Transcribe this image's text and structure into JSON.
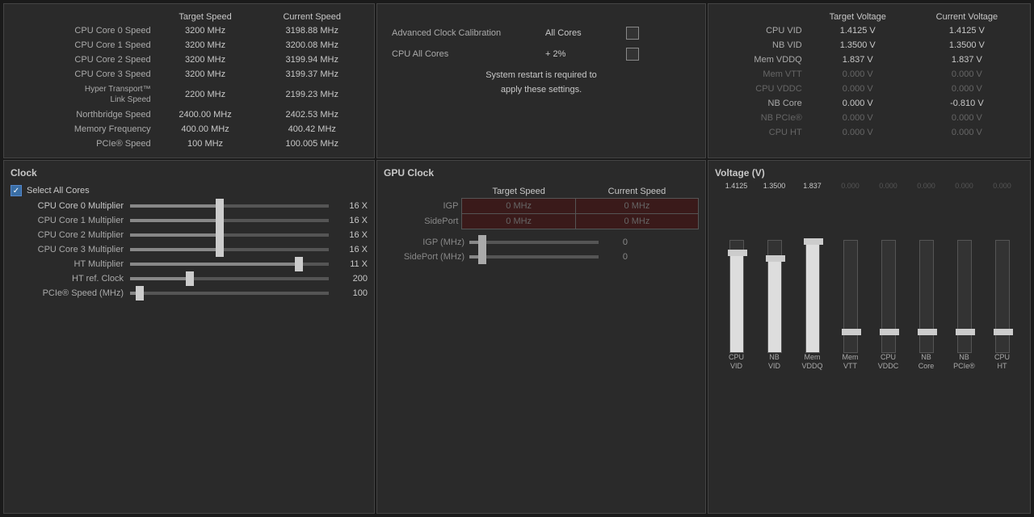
{
  "topLeft": {
    "headers": [
      "",
      "Target Speed",
      "Current Speed"
    ],
    "rows": [
      {
        "label": "CPU Core 0 Speed",
        "target": "3200 MHz",
        "current": "3198.88 MHz"
      },
      {
        "label": "CPU Core 1 Speed",
        "target": "3200 MHz",
        "current": "3200.08 MHz"
      },
      {
        "label": "CPU Core 2 Speed",
        "target": "3200 MHz",
        "current": "3199.94 MHz"
      },
      {
        "label": "CPU Core 3 Speed",
        "target": "3200 MHz",
        "current": "3199.37 MHz"
      },
      {
        "label": "Hyper Transport™ Link Speed",
        "target": "2200 MHz",
        "current": "2199.23 MHz",
        "hyper": true
      },
      {
        "label": "Northbridge Speed",
        "target": "2400.00 MHz",
        "current": "2402.53 MHz"
      },
      {
        "label": "Memory Frequency",
        "target": "400.00 MHz",
        "current": "400.42 MHz"
      },
      {
        "label": "PCIe® Speed",
        "target": "100 MHz",
        "current": "100.005 MHz"
      }
    ]
  },
  "topMid": {
    "calibLabel": "Advanced Clock Calibration",
    "calibValue": "All Cores",
    "cpuLabel": "CPU All Cores",
    "cpuValue": "+ 2%",
    "restartMsg": "System restart is required to\napply these settings."
  },
  "topRight": {
    "headers": [
      "",
      "Target Voltage",
      "Current Voltage"
    ],
    "rows": [
      {
        "label": "CPU VID",
        "target": "1.4125 V",
        "current": "1.4125 V",
        "dimmed": false
      },
      {
        "label": "NB VID",
        "target": "1.3500 V",
        "current": "1.3500 V",
        "dimmed": false
      },
      {
        "label": "Mem VDDQ",
        "target": "1.837 V",
        "current": "1.837 V",
        "dimmed": false
      },
      {
        "label": "Mem VTT",
        "target": "0.000 V",
        "current": "0.000 V",
        "dimmed": true
      },
      {
        "label": "CPU VDDC",
        "target": "0.000 V",
        "current": "0.000 V",
        "dimmed": true
      },
      {
        "label": "NB Core",
        "target": "0.000 V",
        "current": "-0.810 V",
        "dimmed": false
      },
      {
        "label": "NB PCIe®",
        "target": "0.000 V",
        "current": "0.000 V",
        "dimmed": true
      },
      {
        "label": "CPU HT",
        "target": "0.000 V",
        "current": "0.000 V",
        "dimmed": true
      }
    ]
  },
  "botLeft": {
    "title": "Clock",
    "selectAllLabel": "Select All Cores",
    "sliders": [
      {
        "label": "CPU Core 0 Multiplier",
        "value": "16 X",
        "pct": 45,
        "active": true
      },
      {
        "label": "CPU Core 1 Multiplier",
        "value": "16 X",
        "pct": 45,
        "active": false
      },
      {
        "label": "CPU Core 2 Multiplier",
        "value": "16 X",
        "pct": 45,
        "active": false
      },
      {
        "label": "CPU Core 3 Multiplier",
        "value": "16 X",
        "pct": 45,
        "active": false
      },
      {
        "label": "HT Multiplier",
        "value": "11 X",
        "pct": 85,
        "active": false
      },
      {
        "label": "HT ref. Clock",
        "value": "200",
        "pct": 30,
        "active": false
      },
      {
        "label": "PCIe® Speed (MHz)",
        "value": "100",
        "pct": 5,
        "active": false
      }
    ]
  },
  "botMid": {
    "title": "GPU Clock",
    "headers": [
      "",
      "Target Speed",
      "Current Speed"
    ],
    "rows": [
      {
        "label": "IGP",
        "target": "0 MHz",
        "current": "0 MHz"
      },
      {
        "label": "SidePort",
        "target": "0 MHz",
        "current": "0 MHz"
      }
    ],
    "sliders": [
      {
        "label": "IGP (MHz)",
        "value": "0",
        "pct": 10
      },
      {
        "label": "SidePort (MHz)",
        "value": "0",
        "pct": 10
      }
    ]
  },
  "botRight": {
    "title": "Voltage (V)",
    "values": [
      "1.4125",
      "1.3500",
      "1.837",
      "0.000",
      "0.000",
      "0.000",
      "0.000",
      "0.000"
    ],
    "labels": [
      "CPU\nVID",
      "NB\nVID",
      "Mem\nVDDQ",
      "Mem\nVTT",
      "CPU\nVDDC",
      "NB\nCore",
      "NB\nPCIe®",
      "CPU\nHT"
    ],
    "bars": [
      85,
      80,
      95,
      0,
      0,
      0,
      0,
      0
    ],
    "thumbPositions": [
      85,
      80,
      95,
      15,
      15,
      15,
      15,
      15
    ]
  }
}
